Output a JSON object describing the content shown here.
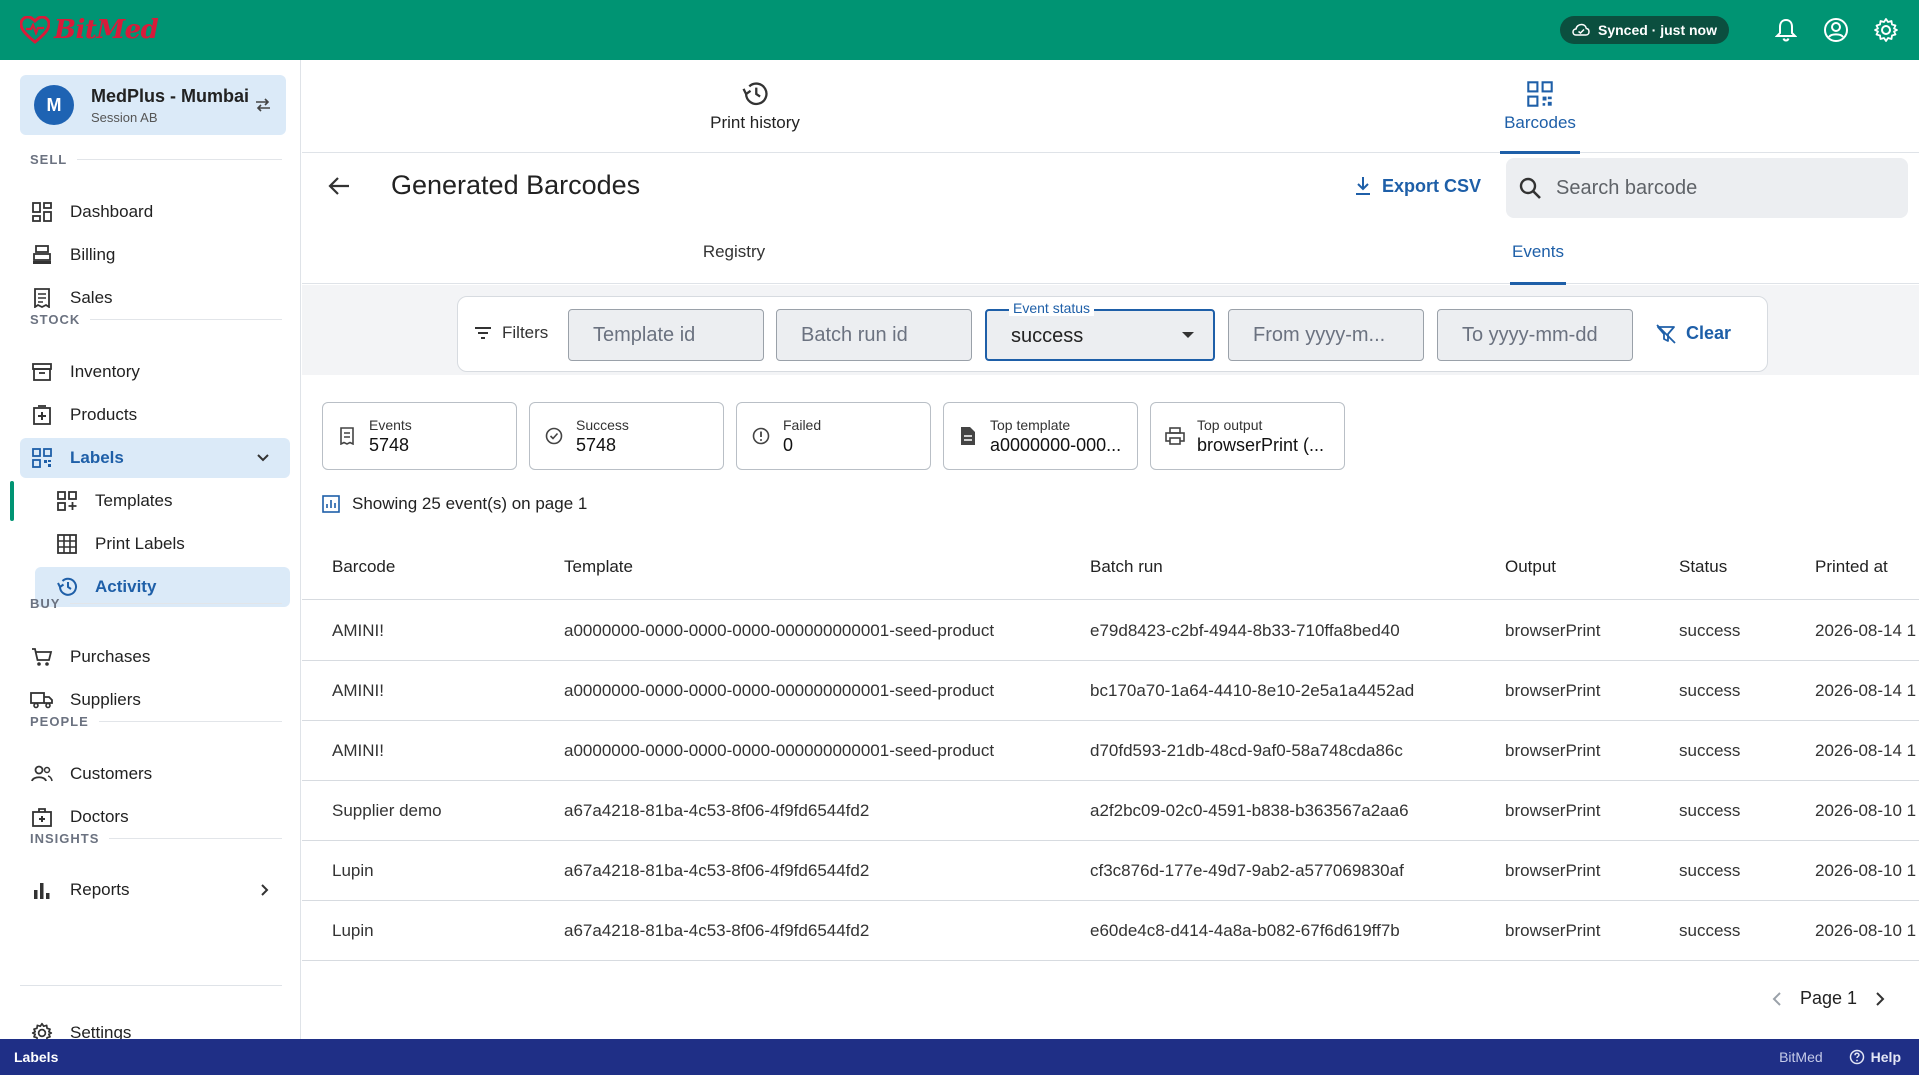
{
  "app": {
    "brand": "BitMed",
    "sync_status": "Synced · just now"
  },
  "org": {
    "initial": "M",
    "name": "MedPlus - Mumbai",
    "session": "Session AB"
  },
  "sidebar": {
    "sections": {
      "sell": "SELL",
      "stock": "STOCK",
      "buy": "BUY",
      "people": "PEOPLE",
      "insights": "INSIGHTS"
    },
    "items": {
      "dashboard": "Dashboard",
      "billing": "Billing",
      "sales": "Sales",
      "inventory": "Inventory",
      "products": "Products",
      "labels": "Labels",
      "templates": "Templates",
      "print_labels": "Print Labels",
      "activity": "Activity",
      "purchases": "Purchases",
      "suppliers": "Suppliers",
      "customers": "Customers",
      "doctors": "Doctors",
      "reports": "Reports",
      "settings": "Settings"
    }
  },
  "top_tabs": {
    "print_history": "Print history",
    "barcodes": "Barcodes"
  },
  "page": {
    "title": "Generated Barcodes",
    "export_label": "Export CSV",
    "search_placeholder": "Search barcode"
  },
  "sub_tabs": {
    "registry": "Registry",
    "events": "Events"
  },
  "filters": {
    "label": "Filters",
    "template_placeholder": "Template id",
    "batch_placeholder": "Batch run id",
    "event_status_label": "Event status",
    "event_status_value": "success",
    "from_placeholder": "From yyyy-m...",
    "to_placeholder": "To yyyy-mm-dd",
    "clear_label": "Clear"
  },
  "stats": {
    "events": {
      "label": "Events",
      "value": "5748"
    },
    "success": {
      "label": "Success",
      "value": "5748"
    },
    "failed": {
      "label": "Failed",
      "value": "0"
    },
    "top_template": {
      "label": "Top template",
      "value": "a0000000-000..."
    },
    "top_output": {
      "label": "Top output",
      "value": "browserPrint (..."
    }
  },
  "showing_text": "Showing 25 event(s) on page 1",
  "table": {
    "columns": [
      "Barcode",
      "Template",
      "Batch run",
      "Output",
      "Status",
      "Printed at"
    ],
    "rows": [
      [
        "AMINI!",
        "a0000000-0000-0000-0000-000000000001-seed-product",
        "e79d8423-c2bf-4944-8b33-710ffa8bed40",
        "browserPrint",
        "success",
        "2026-08-14 1"
      ],
      [
        "AMINI!",
        "a0000000-0000-0000-0000-000000000001-seed-product",
        "bc170a70-1a64-4410-8e10-2e5a1a4452ad",
        "browserPrint",
        "success",
        "2026-08-14 1"
      ],
      [
        "AMINI!",
        "a0000000-0000-0000-0000-000000000001-seed-product",
        "d70fd593-21db-48cd-9af0-58a748cda86c",
        "browserPrint",
        "success",
        "2026-08-14 1"
      ],
      [
        "Supplier demo",
        "a67a4218-81ba-4c53-8f06-4f9fd6544fd2",
        "a2f2bc09-02c0-4591-b838-b363567a2aa6",
        "browserPrint",
        "success",
        "2026-08-10 1"
      ],
      [
        "Lupin",
        "a67a4218-81ba-4c53-8f06-4f9fd6544fd2",
        "cf3c876d-177e-49d7-9ab2-a577069830af",
        "browserPrint",
        "success",
        "2026-08-10 1"
      ],
      [
        "Lupin",
        "a67a4218-81ba-4c53-8f06-4f9fd6544fd2",
        "e60de4c8-d414-4a8a-b082-67f6d619ff7b",
        "browserPrint",
        "success",
        "2026-08-10 1"
      ]
    ]
  },
  "pager": {
    "label": "Page 1"
  },
  "statusbar": {
    "context": "Labels",
    "brand": "BitMed",
    "help": "Help"
  },
  "colors": {
    "topbar": "#009473",
    "accent": "#1e5fa8",
    "statusbar": "#1f2f86",
    "brand_red": "#d81b3a"
  }
}
